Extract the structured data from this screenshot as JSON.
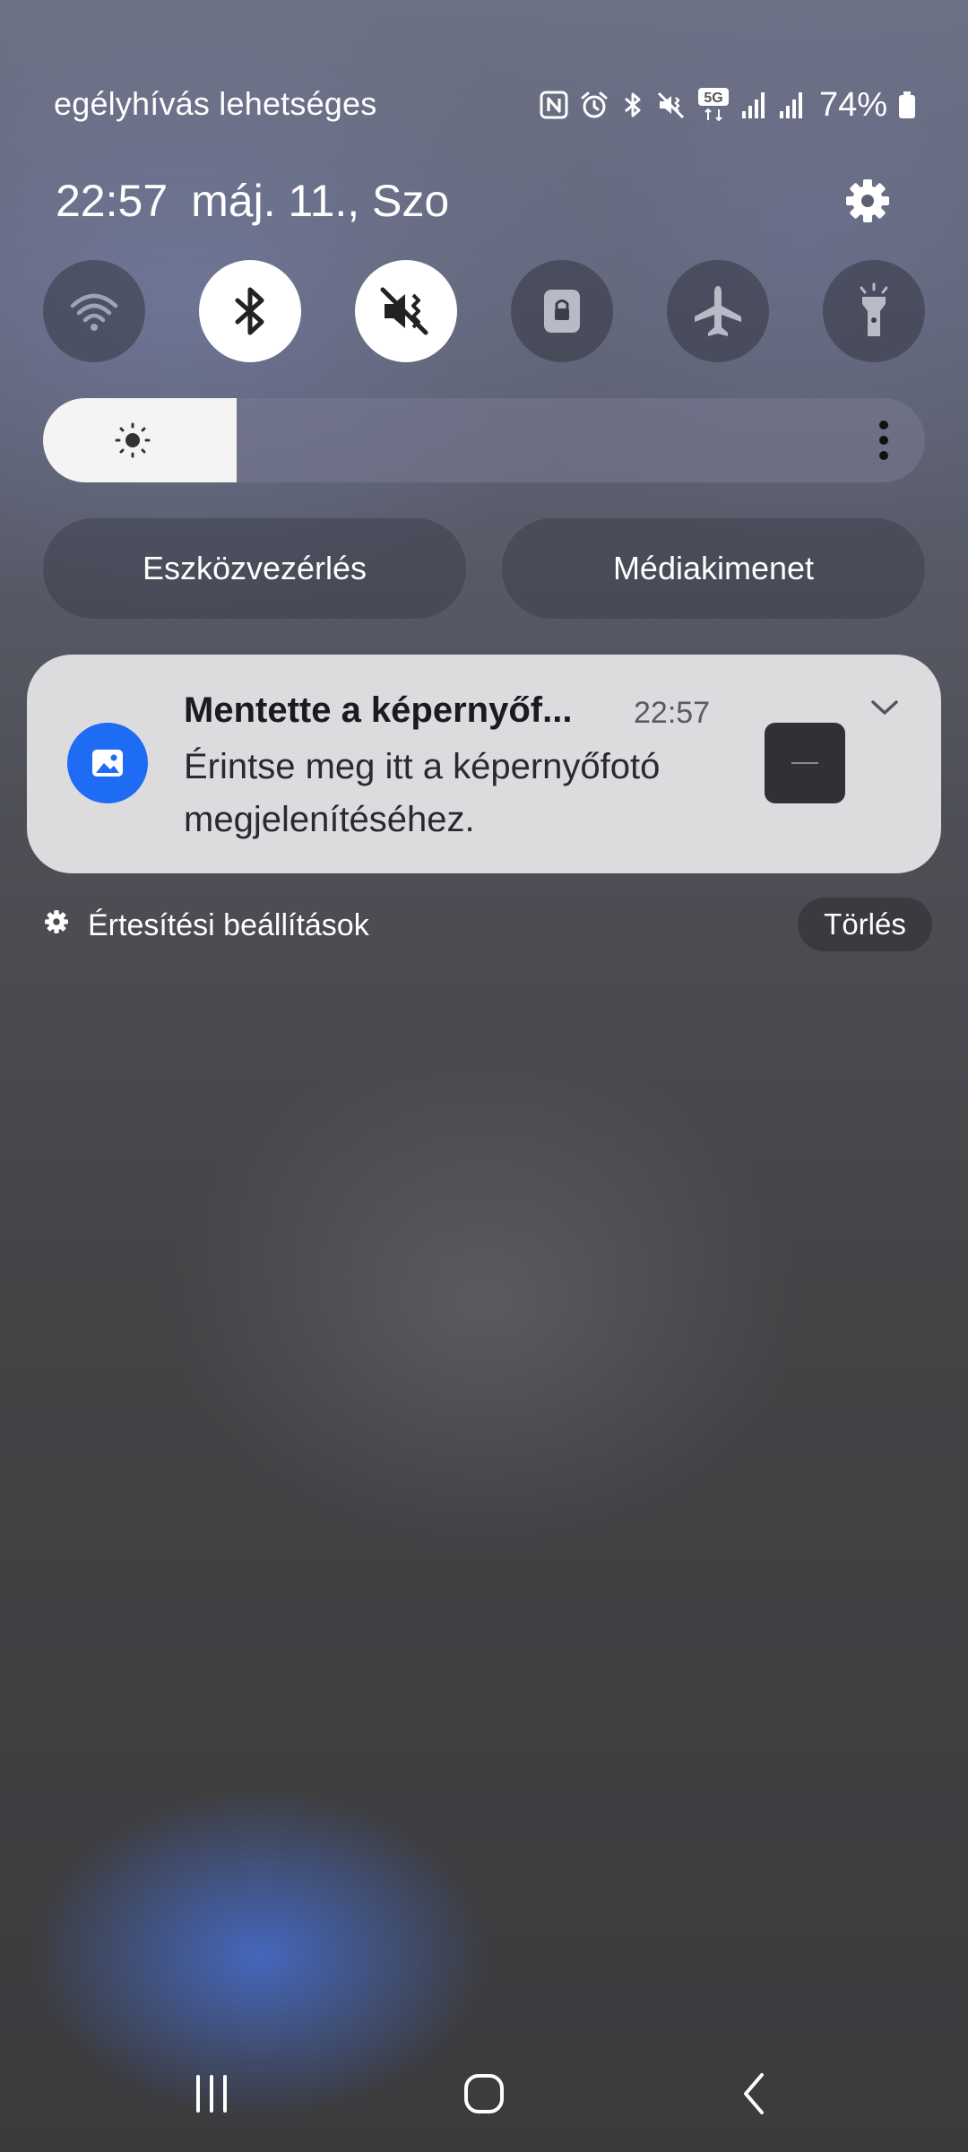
{
  "status_bar": {
    "ticker_text": "egélyhívás lehetséges",
    "battery_percent": "74%",
    "network_badge": "5G",
    "icons": [
      "nfc-icon",
      "alarm-icon",
      "bluetooth-icon",
      "mute-vibrate-icon",
      "5g-icon",
      "signal-icon",
      "signal-icon",
      "battery-icon"
    ]
  },
  "header": {
    "time": "22:57",
    "date": "máj. 11., Szo"
  },
  "quick_toggles": [
    {
      "name": "wifi",
      "on": false
    },
    {
      "name": "bluetooth",
      "on": true
    },
    {
      "name": "vibrate-mute",
      "on": true
    },
    {
      "name": "screen-rotation-lock",
      "on": false
    },
    {
      "name": "airplane-mode",
      "on": false
    },
    {
      "name": "flashlight",
      "on": false
    }
  ],
  "brightness": {
    "level": 0.22
  },
  "panel_buttons": {
    "device_control": "Eszközvezérlés",
    "media_output": "Médiakimenet"
  },
  "notification": {
    "title": "Mentette a képernyőf...",
    "time": "22:57",
    "body": "Érintse meg itt a képernyőfotó megjelenítéséhez.",
    "accent_color": "#1e6cf3"
  },
  "footer": {
    "notification_settings": "Értesítési beállítások",
    "clear": "Törlés"
  }
}
